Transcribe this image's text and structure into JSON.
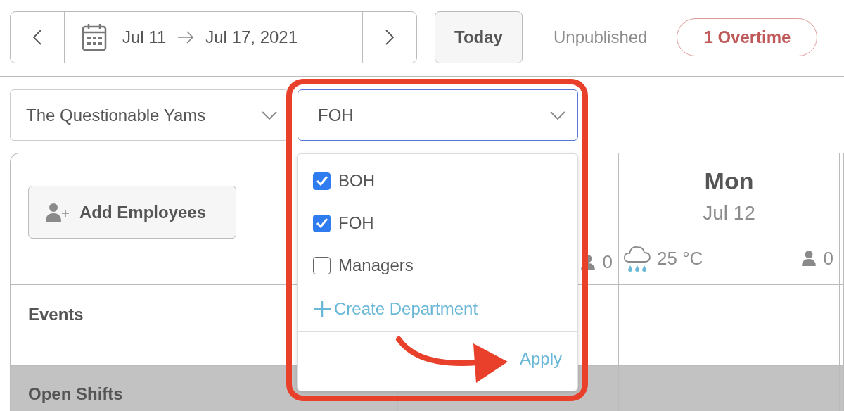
{
  "date_range": {
    "start": "Jul 11",
    "end": "Jul 17, 2021"
  },
  "today_button": "Today",
  "status": "Unpublished",
  "overtime_badge": "1 Overtime",
  "location_select": {
    "value": "The Questionable Yams"
  },
  "department_select": {
    "value": "FOH",
    "expanded": true,
    "options": [
      {
        "label": "BOH",
        "checked": true
      },
      {
        "label": "FOH",
        "checked": true
      },
      {
        "label": "Managers",
        "checked": false
      }
    ],
    "create_link": "Create Department",
    "apply_button": "Apply"
  },
  "schedule": {
    "add_button": "Add Employees",
    "days": [
      {
        "staff_count": "0"
      },
      {
        "weekday": "Mon",
        "date": "Jul 12",
        "temperature": "25 °C",
        "staff_count": "0"
      }
    ],
    "rows": [
      {
        "label": "Events",
        "kind": "plain"
      },
      {
        "label": "Open Shifts",
        "kind": "section"
      }
    ]
  }
}
